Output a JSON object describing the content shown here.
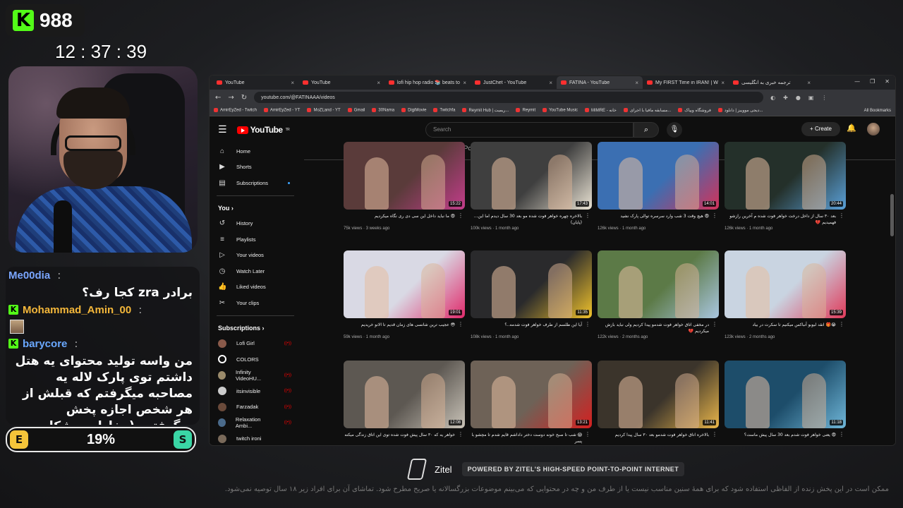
{
  "overlay": {
    "viewer_count": "988",
    "kick_logo": "K",
    "clock": "12 : 37 : 39",
    "chat": [
      {
        "user": "Me00dia",
        "badge": "",
        "message": "برادر zra کجا رف؟"
      },
      {
        "user": "Mohammad_Amin_00",
        "badge": "K",
        "message": ""
      },
      {
        "user": "barycore",
        "badge": "K",
        "message": "من واسه تولید محتوای یه هتل داشتم توی پارک لاله یه مصاحبه میگرفتم که قبلش از هر شخص اجازه پخش میگرفتیم (مخاطب مشکلی نداشت ) و اصلا هیچ"
      }
    ],
    "progress": {
      "left_label": "E",
      "value_text": "19%",
      "right_label": "S",
      "value": 0.19
    },
    "sponsor": {
      "name": "Zitel",
      "tagline": "POWERED BY ZITEL'S HIGH-SPEED POINT-TO-POINT INTERNET"
    },
    "disclaimer": "ممکن است در این پخش زنده از الفاظی استفاده شود که برای همهٔ سنین مناسب نیست یا از طرف من و چه در محتوایی که می‌بینم موضوعات بزرگسالانه یا صریح مطرح شود. تماشای آن برای افراد زیر ۱۸ سال توصیه نمی‌شود."
  },
  "browser": {
    "tabs": [
      {
        "title": "YouTube"
      },
      {
        "title": "YouTube"
      },
      {
        "title": "lofi hip hop radio 📚 beats to"
      },
      {
        "title": "JustChet - YouTube"
      },
      {
        "title": "FATINA - YouTube"
      },
      {
        "title": "My FIRST Time in IRAN! | Was"
      },
      {
        "title": "ترجمه خبری به انگلیسی"
      }
    ],
    "url": "youtube.com/@FATINAAA/videos",
    "bookmarks": [
      "AmirEyZed - Twitch",
      "AmirEyZed - YT",
      "MoZLand - YT",
      "Gmail",
      "30Nama",
      "DigiMovie",
      "Twitchfa",
      "Reymit Hub | ریمیت...",
      "Reymit",
      "YouTube Music",
      "MIMRE - خانه",
      "مسابقه مافیا با اجرای...",
      "فروشگاه ویپاک",
      "دیجی مووییز | دانلود...",
      "All Bookmarks"
    ]
  },
  "youtube": {
    "logo_text": "YouTube",
    "logo_sup": "TR",
    "search_placeholder": "Search",
    "create_label": "Create",
    "sidebar": {
      "main": [
        {
          "label": "Home",
          "icon": "home-icon"
        },
        {
          "label": "Shorts",
          "icon": "shorts-icon"
        },
        {
          "label": "Subscriptions",
          "icon": "subscriptions-icon"
        }
      ],
      "you_heading": "You",
      "you": [
        {
          "label": "History",
          "icon": "history-icon"
        },
        {
          "label": "Playlists",
          "icon": "playlists-icon"
        },
        {
          "label": "Your videos",
          "icon": "your-videos-icon"
        },
        {
          "label": "Watch Later",
          "icon": "watch-later-icon"
        },
        {
          "label": "Liked videos",
          "icon": "liked-icon"
        },
        {
          "label": "Your clips",
          "icon": "clips-icon"
        }
      ],
      "subs_heading": "Subscriptions",
      "subscriptions": [
        {
          "label": "Lofi Girl",
          "live": true
        },
        {
          "label": "COLORS",
          "live": false
        },
        {
          "label": "Infinity VideoHU...",
          "live": true
        },
        {
          "label": "itsinvisible",
          "live": true
        },
        {
          "label": "Farzadak",
          "live": true
        },
        {
          "label": "Relaxation Ambi...",
          "live": true
        },
        {
          "label": "twitch ironi",
          "live": false
        }
      ]
    },
    "channel_tabs": [
      "Home",
      "Videos",
      "Shorts",
      "Playlists",
      "Posts"
    ],
    "active_tab": "Videos",
    "videos": [
      {
        "title": "😨 ما نباید داخل این سی دی ری نگاه میکردیم",
        "meta": "75k views · 3 weeks ago",
        "duration": "15:22",
        "bg": "#5a3b3a",
        "accent": "#c23d8a"
      },
      {
        "title": "بالاخره چهره خواهر فوت شده مو بعد 30 سال دیدم اما این... (پایان)",
        "meta": "100k views · 1 month ago",
        "duration": "17:43",
        "bg": "#3f3f3f",
        "accent": "#e9e2d3"
      },
      {
        "title": "😨 هیچ وقت 3 شب وارد سرسره توالی پارک نشید",
        "meta": "126k views · 1 month ago",
        "duration": "14:01",
        "bg": "#3b6fb2",
        "accent": "#d2325a"
      },
      {
        "title": "بعد ۳۰ سال از داخل درخت خواهر فوت شده م آخرین رازشو فهمیدیم 💔",
        "meta": "126k views · 1 month ago",
        "duration": "20:44",
        "bg": "#24302a",
        "accent": "#5aa0d8"
      },
      {
        "title": "😳 عجیب ترین شانسی های زمان قدیم تا الانو خریدیم",
        "meta": "59k views · 1 month ago",
        "duration": "19:01",
        "bg": "#d9d9e4",
        "accent": "#e02a6b"
      },
      {
        "title": "آیا این طلسم از طرف خواهر فوت شدمه..؟",
        "meta": "108k views · 1 month ago",
        "duration": "11:35",
        "bg": "#2a2a2c",
        "accent": "#f0c22c"
      },
      {
        "title": "در مخفی اتاق خواهر فوت شدمو پیدا کردیم ولی نباید بازش میکردیم 💔",
        "meta": "122k views · 2 months ago",
        "duration": "",
        "bg": "#5c7a47",
        "accent": "#a9c6e0"
      },
      {
        "title": "😭🎁 انقد لبوبو آنباکس میکنیم تا سکرت در بیاد",
        "meta": "123k views · 2 months ago",
        "duration": "15:39",
        "bg": "#c9d4e1",
        "accent": "#e03a5a"
      },
      {
        "title": "خواهر یه که ۳۰ سال پیش فوت شده توی این اتاق زندگی میکنه",
        "meta": "",
        "duration": "12:08",
        "bg": "#5d5852",
        "accent": "#c9c3b8"
      },
      {
        "title": "😱 شب تا صبح خونه دوست دختر داداشم قایم شدم تا مچشو با پسر",
        "meta": "",
        "duration": "13:21",
        "bg": "#6e6257",
        "accent": "#d42020"
      },
      {
        "title": "بالاخره اتاق خواهر فوت شدمو بعد ۳۰ سال پیدا کردیم",
        "meta": "145k views · 2 months ago",
        "duration": "11:41",
        "bg": "#3b342b",
        "accent": "#e8b54a"
      },
      {
        "title": "😨 یعنی خواهر فوت شدم بعد 30 سال پیش ماست؟",
        "meta": "",
        "duration": "11:18",
        "bg": "#1d4d6a",
        "accent": "#6fb6d8"
      }
    ]
  }
}
